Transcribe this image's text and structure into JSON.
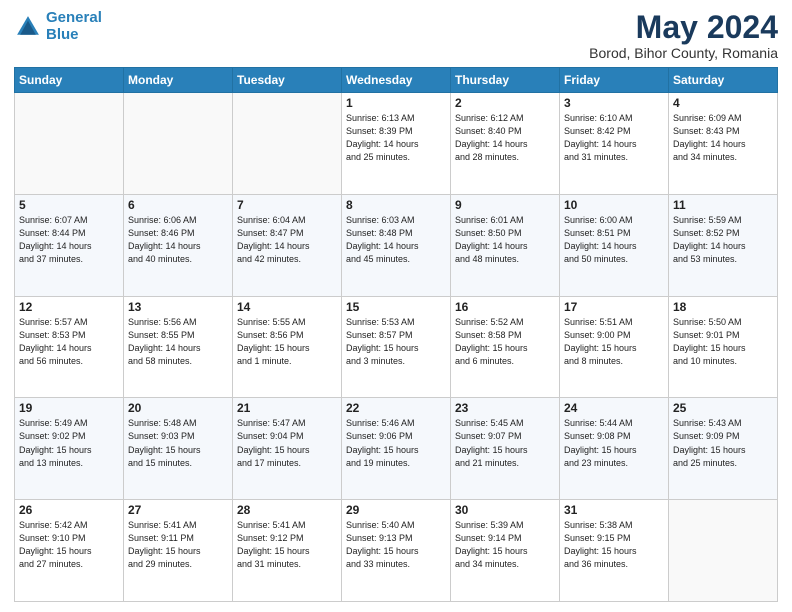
{
  "header": {
    "logo_line1": "General",
    "logo_line2": "Blue",
    "title": "May 2024",
    "subtitle": "Borod, Bihor County, Romania"
  },
  "days_of_week": [
    "Sunday",
    "Monday",
    "Tuesday",
    "Wednesday",
    "Thursday",
    "Friday",
    "Saturday"
  ],
  "weeks": [
    [
      {
        "day": "",
        "info": ""
      },
      {
        "day": "",
        "info": ""
      },
      {
        "day": "",
        "info": ""
      },
      {
        "day": "1",
        "info": "Sunrise: 6:13 AM\nSunset: 8:39 PM\nDaylight: 14 hours\nand 25 minutes."
      },
      {
        "day": "2",
        "info": "Sunrise: 6:12 AM\nSunset: 8:40 PM\nDaylight: 14 hours\nand 28 minutes."
      },
      {
        "day": "3",
        "info": "Sunrise: 6:10 AM\nSunset: 8:42 PM\nDaylight: 14 hours\nand 31 minutes."
      },
      {
        "day": "4",
        "info": "Sunrise: 6:09 AM\nSunset: 8:43 PM\nDaylight: 14 hours\nand 34 minutes."
      }
    ],
    [
      {
        "day": "5",
        "info": "Sunrise: 6:07 AM\nSunset: 8:44 PM\nDaylight: 14 hours\nand 37 minutes."
      },
      {
        "day": "6",
        "info": "Sunrise: 6:06 AM\nSunset: 8:46 PM\nDaylight: 14 hours\nand 40 minutes."
      },
      {
        "day": "7",
        "info": "Sunrise: 6:04 AM\nSunset: 8:47 PM\nDaylight: 14 hours\nand 42 minutes."
      },
      {
        "day": "8",
        "info": "Sunrise: 6:03 AM\nSunset: 8:48 PM\nDaylight: 14 hours\nand 45 minutes."
      },
      {
        "day": "9",
        "info": "Sunrise: 6:01 AM\nSunset: 8:50 PM\nDaylight: 14 hours\nand 48 minutes."
      },
      {
        "day": "10",
        "info": "Sunrise: 6:00 AM\nSunset: 8:51 PM\nDaylight: 14 hours\nand 50 minutes."
      },
      {
        "day": "11",
        "info": "Sunrise: 5:59 AM\nSunset: 8:52 PM\nDaylight: 14 hours\nand 53 minutes."
      }
    ],
    [
      {
        "day": "12",
        "info": "Sunrise: 5:57 AM\nSunset: 8:53 PM\nDaylight: 14 hours\nand 56 minutes."
      },
      {
        "day": "13",
        "info": "Sunrise: 5:56 AM\nSunset: 8:55 PM\nDaylight: 14 hours\nand 58 minutes."
      },
      {
        "day": "14",
        "info": "Sunrise: 5:55 AM\nSunset: 8:56 PM\nDaylight: 15 hours\nand 1 minute."
      },
      {
        "day": "15",
        "info": "Sunrise: 5:53 AM\nSunset: 8:57 PM\nDaylight: 15 hours\nand 3 minutes."
      },
      {
        "day": "16",
        "info": "Sunrise: 5:52 AM\nSunset: 8:58 PM\nDaylight: 15 hours\nand 6 minutes."
      },
      {
        "day": "17",
        "info": "Sunrise: 5:51 AM\nSunset: 9:00 PM\nDaylight: 15 hours\nand 8 minutes."
      },
      {
        "day": "18",
        "info": "Sunrise: 5:50 AM\nSunset: 9:01 PM\nDaylight: 15 hours\nand 10 minutes."
      }
    ],
    [
      {
        "day": "19",
        "info": "Sunrise: 5:49 AM\nSunset: 9:02 PM\nDaylight: 15 hours\nand 13 minutes."
      },
      {
        "day": "20",
        "info": "Sunrise: 5:48 AM\nSunset: 9:03 PM\nDaylight: 15 hours\nand 15 minutes."
      },
      {
        "day": "21",
        "info": "Sunrise: 5:47 AM\nSunset: 9:04 PM\nDaylight: 15 hours\nand 17 minutes."
      },
      {
        "day": "22",
        "info": "Sunrise: 5:46 AM\nSunset: 9:06 PM\nDaylight: 15 hours\nand 19 minutes."
      },
      {
        "day": "23",
        "info": "Sunrise: 5:45 AM\nSunset: 9:07 PM\nDaylight: 15 hours\nand 21 minutes."
      },
      {
        "day": "24",
        "info": "Sunrise: 5:44 AM\nSunset: 9:08 PM\nDaylight: 15 hours\nand 23 minutes."
      },
      {
        "day": "25",
        "info": "Sunrise: 5:43 AM\nSunset: 9:09 PM\nDaylight: 15 hours\nand 25 minutes."
      }
    ],
    [
      {
        "day": "26",
        "info": "Sunrise: 5:42 AM\nSunset: 9:10 PM\nDaylight: 15 hours\nand 27 minutes."
      },
      {
        "day": "27",
        "info": "Sunrise: 5:41 AM\nSunset: 9:11 PM\nDaylight: 15 hours\nand 29 minutes."
      },
      {
        "day": "28",
        "info": "Sunrise: 5:41 AM\nSunset: 9:12 PM\nDaylight: 15 hours\nand 31 minutes."
      },
      {
        "day": "29",
        "info": "Sunrise: 5:40 AM\nSunset: 9:13 PM\nDaylight: 15 hours\nand 33 minutes."
      },
      {
        "day": "30",
        "info": "Sunrise: 5:39 AM\nSunset: 9:14 PM\nDaylight: 15 hours\nand 34 minutes."
      },
      {
        "day": "31",
        "info": "Sunrise: 5:38 AM\nSunset: 9:15 PM\nDaylight: 15 hours\nand 36 minutes."
      },
      {
        "day": "",
        "info": ""
      }
    ]
  ]
}
